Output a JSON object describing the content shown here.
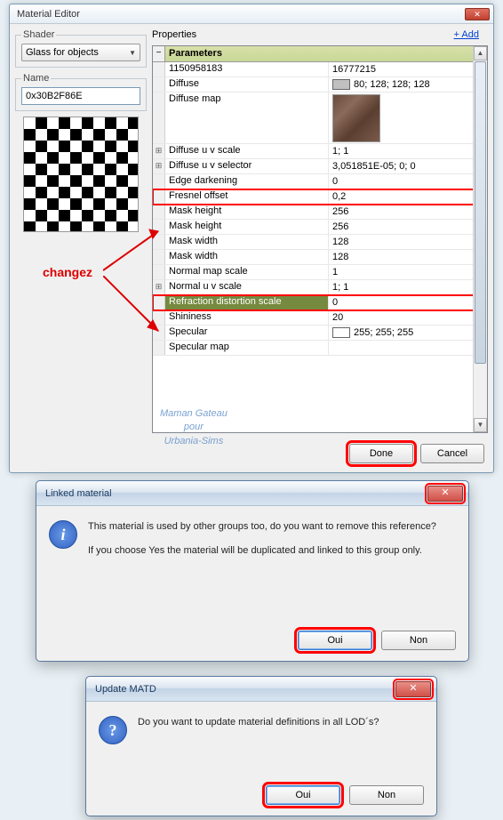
{
  "win1": {
    "title": "Material Editor",
    "shader_label": "Shader",
    "shader_value": "Glass for objects",
    "name_label": "Name",
    "name_value": "0x30B2F86E",
    "properties_label": "Properties",
    "add_link": "+ Add",
    "group_label": "Parameters",
    "rows": [
      {
        "k": "1150958183",
        "v": "16777215"
      },
      {
        "k": "Diffuse",
        "v": "80; 128; 128; 128",
        "swatch": "#c0c0c0"
      },
      {
        "k": "Diffuse map",
        "v": "",
        "texture": true
      },
      {
        "k": "Diffuse u v scale",
        "v": "1; 1",
        "expand": true
      },
      {
        "k": "Diffuse u v selector",
        "v": "3,051851E-05; 0; 0",
        "expand": true
      },
      {
        "k": "Edge darkening",
        "v": "0"
      },
      {
        "k": "Fresnel offset",
        "v": "0,2",
        "redbox": true
      },
      {
        "k": "Mask height",
        "v": "256"
      },
      {
        "k": "Mask height",
        "v": "256"
      },
      {
        "k": "Mask width",
        "v": "128"
      },
      {
        "k": "Mask width",
        "v": "128"
      },
      {
        "k": "Normal map scale",
        "v": "1"
      },
      {
        "k": "Normal u v scale",
        "v": "1; 1",
        "expand": true
      },
      {
        "k": "Refraction distortion scale",
        "v": "0",
        "redbox": true,
        "selected": true
      },
      {
        "k": "Shininess",
        "v": "20"
      },
      {
        "k": "Specular",
        "v": "255; 255; 255",
        "swatch": "#ffffff"
      },
      {
        "k": "Specular map",
        "v": ""
      }
    ],
    "done": "Done",
    "cancel": "Cancel"
  },
  "annotation": "changez",
  "watermark": {
    "l1": "Maman Gateau",
    "l2": "pour",
    "l3": "Urbania-Sims"
  },
  "dlg2": {
    "title": "Linked material",
    "line1": "This material is used by other groups too, do you want to remove this reference?",
    "line2": "If you choose Yes the material will be duplicated and linked to this group only.",
    "yes": "Oui",
    "no": "Non"
  },
  "dlg3": {
    "title": "Update MATD",
    "line1": "Do you want to update material definitions in all LOD´s?",
    "yes": "Oui",
    "no": "Non"
  }
}
